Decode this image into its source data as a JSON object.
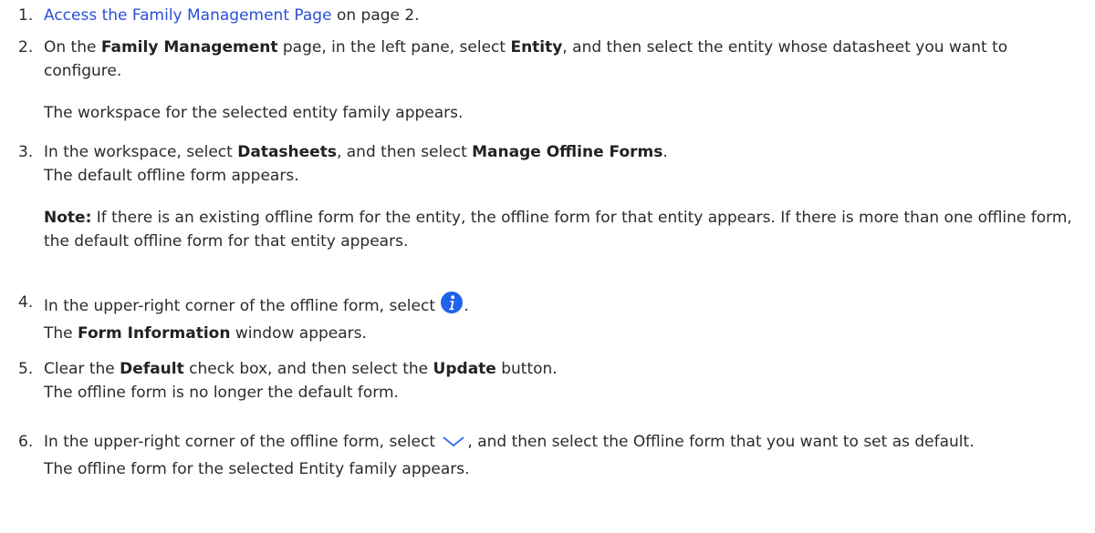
{
  "steps": [
    {
      "number": "1.",
      "link": "Access the Family Management Page",
      "after_link": " on page 2."
    },
    {
      "number": "2.",
      "t1": "On the ",
      "b1": "Family Management",
      "t2": " page, in the left pane, select ",
      "b2": "Entity",
      "t3": ", and then select the entity whose datasheet you want to configure.",
      "result": "The workspace for the selected entity family appears."
    },
    {
      "number": "3.",
      "t1": "In the workspace, select ",
      "b1": "Datasheets",
      "t2": ", and then select ",
      "b2": "Manage Offline Forms",
      "t3": ".",
      "result": "The default offline form appears.",
      "note_label": "Note:",
      "note_text": " If there is an existing offline form for the entity, the offline form for that entity appears. If there is more than one offline form, the default offline form for that entity appears."
    },
    {
      "number": "4.",
      "t1": "In the upper-right corner of the offline form, select ",
      "t2": ".",
      "r1": "The ",
      "rb": "Form Information",
      "r2": " window appears."
    },
    {
      "number": "5.",
      "t1": "Clear the ",
      "b1": "Default",
      "t2": " check box, and then select the ",
      "b2": "Update",
      "t3": " button.",
      "result": "The offline form is no longer the default form."
    },
    {
      "number": "6.",
      "t1": "In the upper-right corner of the offline form, select ",
      "t2": ", and then select the Offline form that you want to set as default.",
      "result": "The offline form for the selected Entity family appears."
    }
  ],
  "colors": {
    "link": "#2a4fd6",
    "icon_blue": "#1e63e9",
    "text": "#2b2b2b"
  }
}
